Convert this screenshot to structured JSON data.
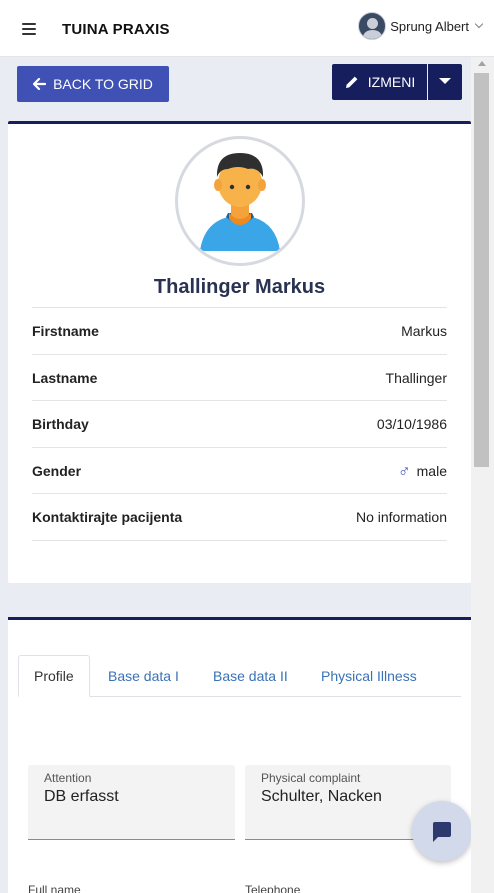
{
  "app": {
    "title": "TUINA PRAXIS"
  },
  "user": {
    "name": "Sprung Albert"
  },
  "actions": {
    "back_label": "BACK TO GRID",
    "edit_label": "IZMENI"
  },
  "patient": {
    "full_name": "Thallinger Markus",
    "rows": [
      {
        "label": "Firstname",
        "value": "Markus"
      },
      {
        "label": "Lastname",
        "value": "Thallinger"
      },
      {
        "label": "Birthday",
        "value": "03/10/1986"
      },
      {
        "label": "Gender",
        "value": "male",
        "icon": "male-icon"
      },
      {
        "label": "Kontaktirajte pacijenta",
        "value": "No information"
      }
    ]
  },
  "tabs": [
    {
      "label": "Profile",
      "active": true
    },
    {
      "label": "Base data I"
    },
    {
      "label": "Base data II"
    },
    {
      "label": "Physical Illness"
    }
  ],
  "form": {
    "attention": {
      "label": "Attention",
      "value": "DB erfasst"
    },
    "physical_complaint": {
      "label": "Physical complaint",
      "value": "Schulter, Nacken"
    },
    "full_name_label": "Full name",
    "telephone_label": "Telephone"
  },
  "icons": {
    "menu": "hamburger-icon",
    "chat": "chat-icon",
    "back": "arrow-left-icon",
    "edit": "pencil-icon",
    "dropdown": "caret-down-icon"
  },
  "colors": {
    "primary": "#3f51b5",
    "dark_primary": "#161e5e",
    "link": "#3a72b5"
  }
}
